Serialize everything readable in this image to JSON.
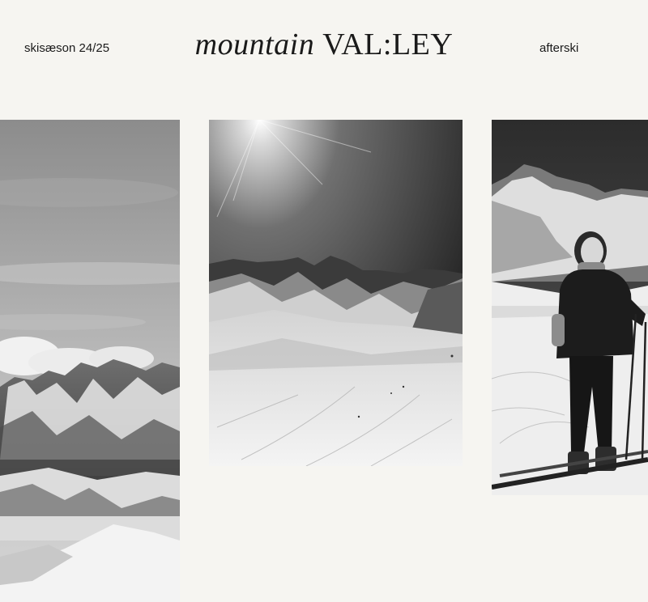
{
  "header": {
    "season_link": "skisæson 24/25",
    "logo_italic": "mountain",
    "logo_caps": "VAL:LEY",
    "afterski_link": "afterski"
  },
  "gallery": {
    "photos": [
      {
        "name": "snowy-peaks-photo"
      },
      {
        "name": "ski-slope-sun-photo"
      },
      {
        "name": "skier-portrait-photo"
      }
    ]
  }
}
